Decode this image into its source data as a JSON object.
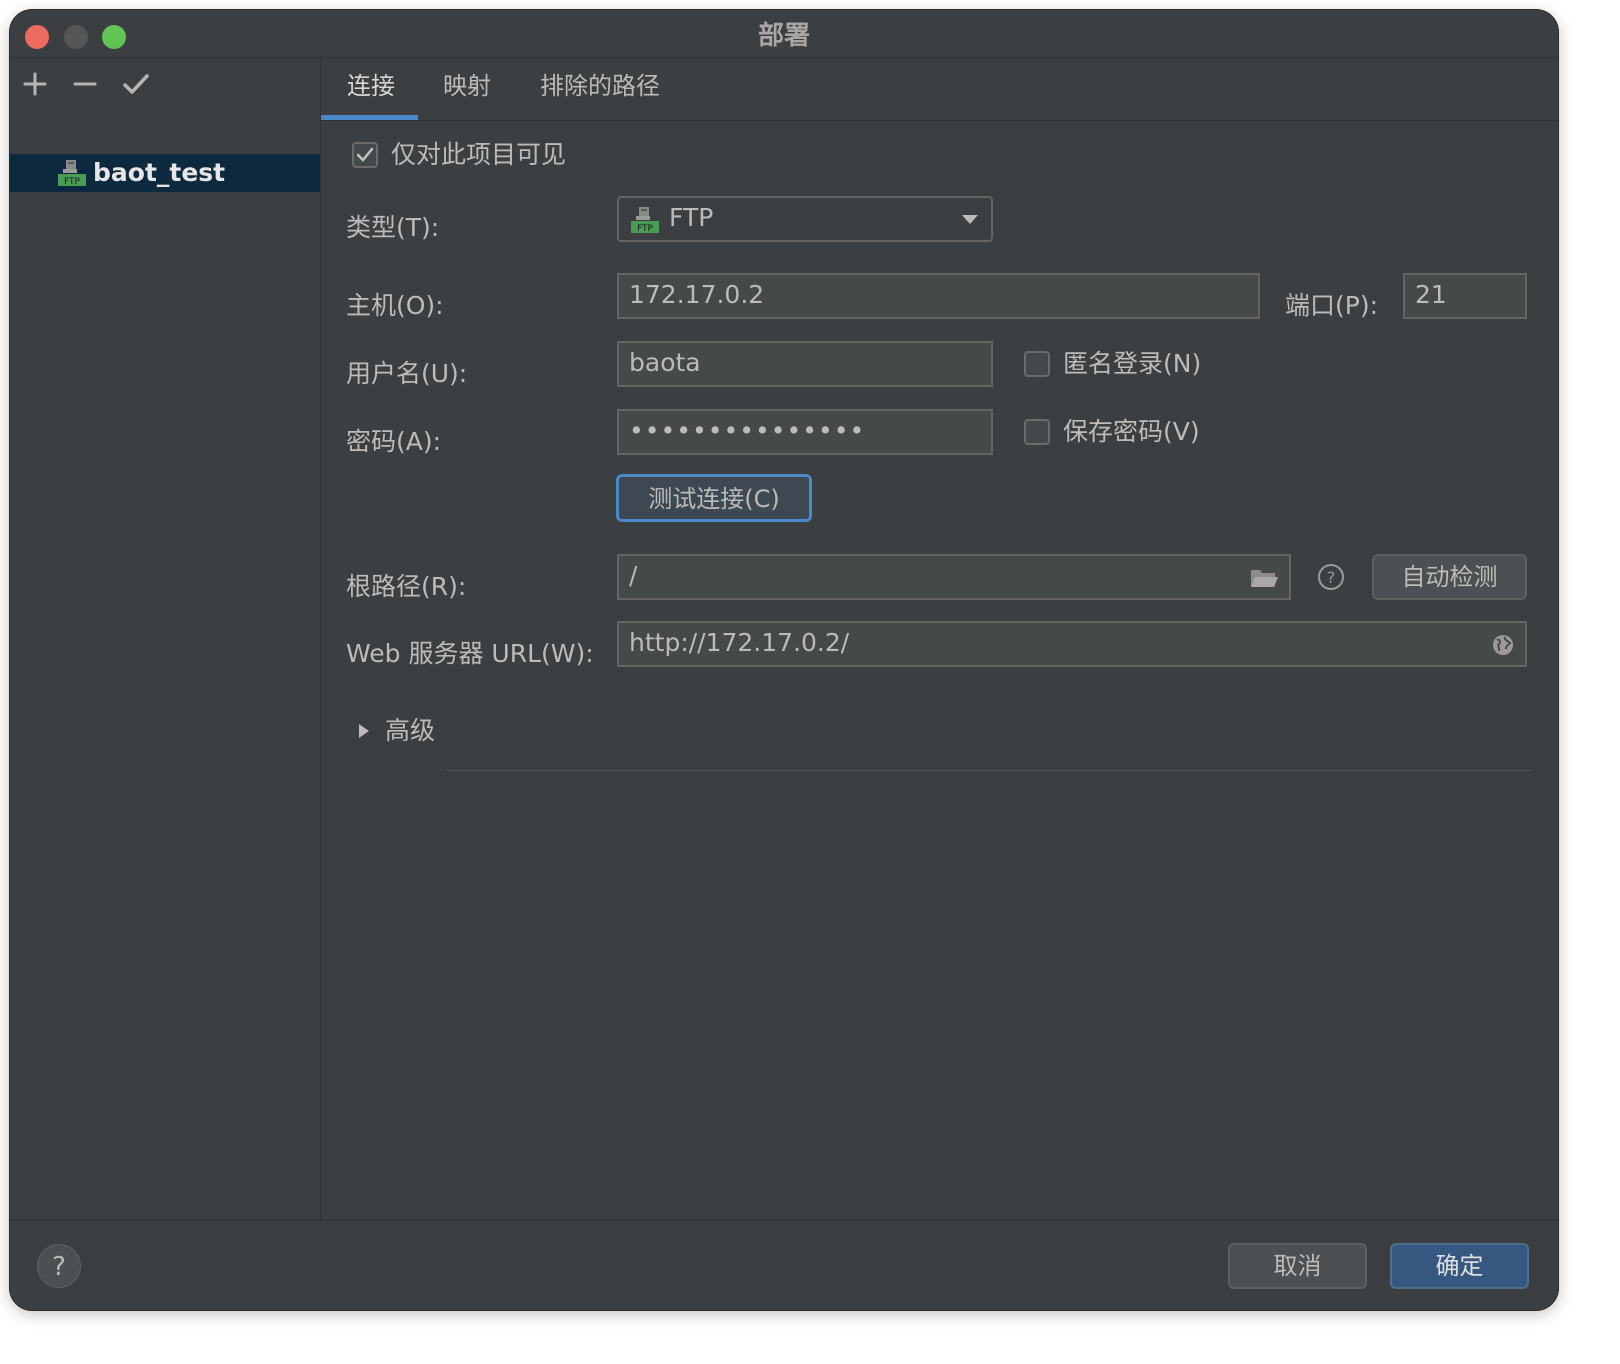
{
  "window": {
    "title": "部署"
  },
  "sidebar": {
    "toolbar": {
      "add": "add",
      "remove": "remove",
      "apply": "apply"
    },
    "items": [
      {
        "label": "baot_test",
        "icon": "ftp-icon"
      }
    ]
  },
  "tabs": [
    {
      "label": "连接",
      "active": true
    },
    {
      "label": "映射"
    },
    {
      "label": "排除的路径"
    }
  ],
  "form": {
    "visible_only": {
      "label": "仅对此项目可见",
      "checked": true
    },
    "type": {
      "label": "类型(T):",
      "value": "FTP"
    },
    "host": {
      "label": "主机(O):",
      "value": "172.17.0.2"
    },
    "port": {
      "label": "端口(P):",
      "value": "21"
    },
    "username": {
      "label": "用户名(U):",
      "value": "baota"
    },
    "anonymous": {
      "label": "匿名登录(N)",
      "checked": false
    },
    "password": {
      "label": "密码(A):",
      "value": "•••••••••••••••"
    },
    "save_password": {
      "label": "保存密码(V)",
      "checked": false
    },
    "test_button": "测试连接(C)",
    "root_path": {
      "label": "根路径(R):",
      "value": "/"
    },
    "auto_detect": "自动检测",
    "web_url": {
      "label": "Web 服务器 URL(W):",
      "value": "http://172.17.0.2/"
    },
    "advanced": "高级"
  },
  "footer": {
    "cancel": "取消",
    "ok": "确定",
    "help": "?"
  },
  "colors": {
    "accent": "#4a88c7",
    "ok_button": "#365880",
    "background": "#3c3f41"
  }
}
